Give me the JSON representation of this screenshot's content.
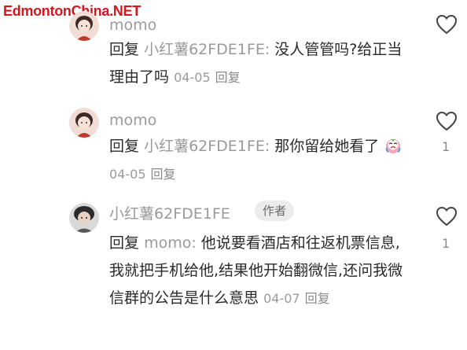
{
  "watermark": "EdmontonChina.NET",
  "comments": [
    {
      "username": "momo",
      "reply_prefix": "回复",
      "reply_to": "小红薯62FDE1FE:",
      "text": "没人管管吗?给正当理由了吗",
      "date": "04-05",
      "reply_label": "回复",
      "likes": ""
    },
    {
      "username": "momo",
      "reply_prefix": "回复",
      "reply_to": "小红薯62FDE1FE:",
      "text": "那你留给她看了",
      "date": "04-05",
      "reply_label": "回复",
      "likes": "1"
    },
    {
      "username": "小红薯62FDE1FE",
      "author_tag": "作者",
      "reply_prefix": "回复",
      "reply_to": "momo:",
      "text": "他说要看酒店和往返机票信息,我就把手机给他,结果他开始翻微信,还问我微信群的公告是什么意思",
      "date": "04-07",
      "reply_label": "回复",
      "likes": "1"
    }
  ],
  "colors": {
    "watermark": "#d4161f",
    "username": "#9a9a9a",
    "text": "#2a2a2a"
  }
}
